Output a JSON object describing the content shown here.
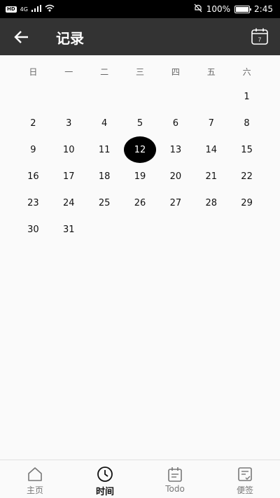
{
  "status_bar": {
    "hd_badge": "HD",
    "network": "4G",
    "battery_text": "100%",
    "time": "2:45",
    "icons": [
      "signal-icon",
      "wifi-icon",
      "mute-icon",
      "battery-icon"
    ]
  },
  "app_bar": {
    "title": "记录",
    "calendar_button_day": "7"
  },
  "calendar": {
    "weekday_headers": [
      "日",
      "一",
      "二",
      "三",
      "四",
      "五",
      "六"
    ],
    "leading_blanks": 6,
    "days": [
      "1",
      "2",
      "3",
      "4",
      "5",
      "6",
      "7",
      "8",
      "9",
      "10",
      "11",
      "12",
      "13",
      "14",
      "15",
      "16",
      "17",
      "18",
      "19",
      "20",
      "21",
      "22",
      "23",
      "24",
      "25",
      "26",
      "27",
      "28",
      "29",
      "30",
      "31"
    ],
    "selected_day": "12"
  },
  "bottom_nav": {
    "items": [
      {
        "label": "主页",
        "icon": "home-icon"
      },
      {
        "label": "时间",
        "icon": "clock-icon"
      },
      {
        "label": "Todo",
        "icon": "todo-icon"
      },
      {
        "label": "便签",
        "icon": "note-icon"
      }
    ],
    "active_index": 1
  }
}
